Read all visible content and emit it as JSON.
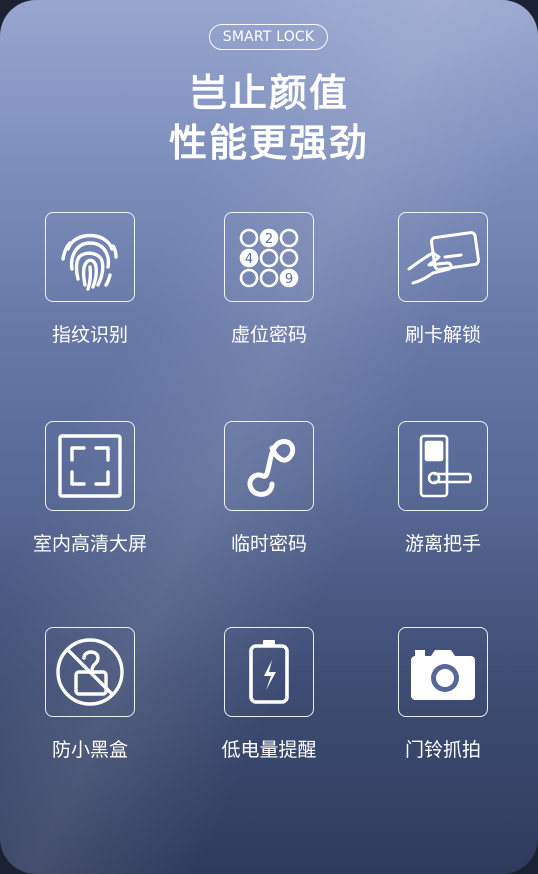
{
  "badge": "SMART LOCK",
  "headline": {
    "line1": "岂止颜值",
    "line2": "性能更强劲"
  },
  "features": [
    {
      "label": "指纹识别",
      "icon": "fingerprint-icon"
    },
    {
      "label": "虚位密码",
      "icon": "keypad-icon",
      "keypad_digits": [
        "2",
        "4",
        "9"
      ]
    },
    {
      "label": "刷卡解锁",
      "icon": "card-swipe-icon"
    },
    {
      "label": "室内高清大屏",
      "icon": "screen-frame-icon"
    },
    {
      "label": "临时密码",
      "icon": "temporary-code-icon"
    },
    {
      "label": "游离把手",
      "icon": "door-handle-icon"
    },
    {
      "label": "防小黑盒",
      "icon": "anti-black-box-icon"
    },
    {
      "label": "低电量提醒",
      "icon": "low-battery-icon"
    },
    {
      "label": "门铃抓拍",
      "icon": "camera-icon"
    }
  ]
}
